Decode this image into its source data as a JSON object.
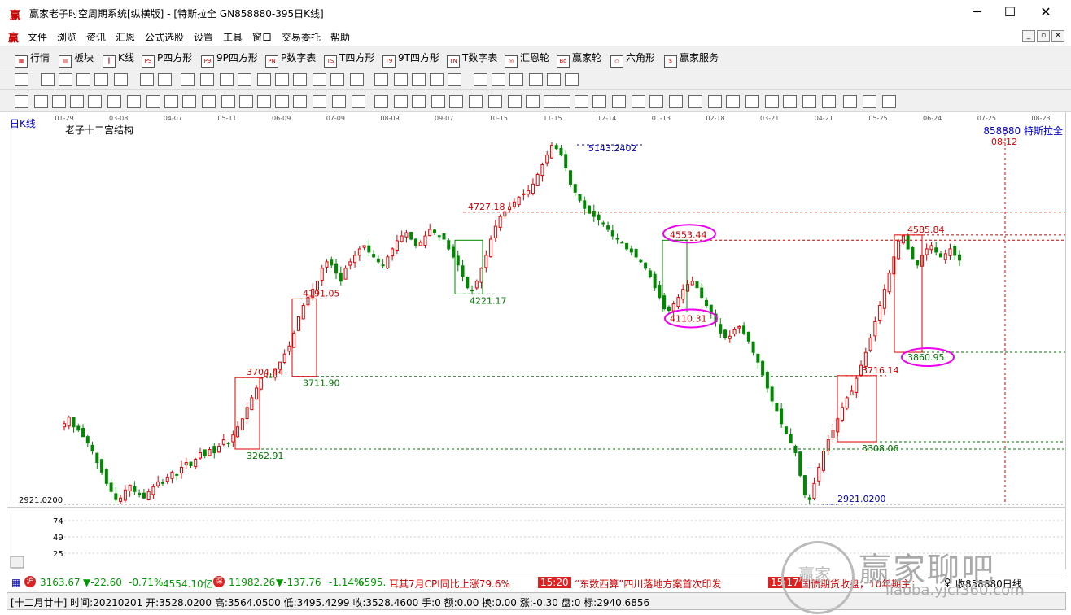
{
  "window": {
    "app_logo": "赢",
    "title": "赢家老子时空周期系统[纵横版] - [特斯拉全  GN858880-395日K线]",
    "minimize": "─",
    "maximize": "☐",
    "close": "✕"
  },
  "menu": {
    "logo": "赢",
    "items": [
      "文件",
      "浏览",
      "资讯",
      "汇恩",
      "公式选股",
      "设置",
      "工具",
      "窗口",
      "交易委托",
      "帮助"
    ],
    "mdi_buttons": [
      "_",
      "▫",
      "✕"
    ]
  },
  "toolbar1": {
    "items": [
      {
        "icon": "▦",
        "label": "行情"
      },
      {
        "icon": "▥",
        "label": "板块"
      },
      {
        "icon": "┃",
        "label": "K线"
      },
      {
        "icon": "PS",
        "label": "P四方形"
      },
      {
        "icon": "P9",
        "label": "9P四方形"
      },
      {
        "icon": "PN",
        "label": "P数字表"
      },
      {
        "icon": "TS",
        "label": "T四方形"
      },
      {
        "icon": "T9",
        "label": "9T四方形"
      },
      {
        "icon": "TN",
        "label": "T数字表"
      },
      {
        "icon": "◎",
        "label": "汇恩轮"
      },
      {
        "icon": "Bd",
        "label": "赢家轮"
      },
      {
        "icon": "◇",
        "label": "六角形"
      },
      {
        "icon": "$",
        "label": "赢家服务"
      }
    ]
  },
  "chart_header": {
    "period": "日K线",
    "indicator": "老子十二宫结构",
    "code_name": "858880 特斯拉全",
    "cursor_date": "08-12"
  },
  "chart_data": {
    "type": "candlestick",
    "x_ticks": [
      "01-29",
      "03-08",
      "04-07",
      "05-11",
      "06-09",
      "07-09",
      "08-09",
      "09-07",
      "10-15",
      "11-15",
      "12-14",
      "01-13",
      "02-18",
      "03-21",
      "04-21",
      "05-25",
      "06-24",
      "07-25",
      "08-23"
    ],
    "y_axis_min_label": "2921.0200",
    "sub_axis_ticks": [
      "74",
      "49",
      "25"
    ],
    "levels": [
      {
        "label": "5143.2402",
        "value": 5143.24,
        "color": "#0000aa"
      },
      {
        "label": "4727.18",
        "value": 4727.18,
        "color": "#cc0000"
      },
      {
        "label": "4585.84",
        "value": 4585.84,
        "color": "#cc0000"
      },
      {
        "label": "4553.44",
        "value": 4553.44,
        "color": "#cc0000"
      },
      {
        "label": "4221.17",
        "value": 4221.17,
        "color": "#007700"
      },
      {
        "label": "4191.05",
        "value": 4191.05,
        "color": "#cc0000"
      },
      {
        "label": "4110.31",
        "value": 4110.31,
        "color": "#cc0000"
      },
      {
        "label": "3860.95",
        "value": 3860.95,
        "color": "#007700"
      },
      {
        "label": "3716.14",
        "value": 3716.14,
        "color": "#cc0000"
      },
      {
        "label": "3711.90",
        "value": 3711.9,
        "color": "#007700"
      },
      {
        "label": "3704.44",
        "value": 3704.44,
        "color": "#cc0000"
      },
      {
        "label": "3308.06",
        "value": 3308.06,
        "color": "#007700"
      },
      {
        "label": "3262.91",
        "value": 3262.91,
        "color": "#007700"
      },
      {
        "label": "2921.0200",
        "value": 2921.02,
        "color": "#0000aa"
      }
    ],
    "ylim": [
      2921.02,
      5143.24
    ],
    "price_path": [
      3420,
      3460,
      3400,
      3380,
      3340,
      3300,
      3250,
      3180,
      3120,
      3050,
      3000,
      2950,
      2960,
      3010,
      3040,
      3000,
      2980,
      2960,
      3000,
      3030,
      3060,
      3050,
      3090,
      3120,
      3100,
      3150,
      3180,
      3160,
      3200,
      3240,
      3220,
      3260,
      3240,
      3280,
      3320,
      3300,
      3350,
      3400,
      3450,
      3520,
      3580,
      3640,
      3700,
      3730,
      3710,
      3760,
      3800,
      3850,
      3900,
      3980,
      4080,
      4150,
      4200,
      4250,
      4300,
      4380,
      4420,
      4400,
      4350,
      4300,
      4380,
      4420,
      4460,
      4500,
      4520,
      4480,
      4450,
      4420,
      4400,
      4450,
      4500,
      4550,
      4580,
      4600,
      4560,
      4520,
      4540,
      4580,
      4620,
      4600,
      4580,
      4560,
      4500,
      4450,
      4400,
      4330,
      4260,
      4240,
      4300,
      4380,
      4460,
      4560,
      4640,
      4700,
      4730,
      4760,
      4790,
      4820,
      4840,
      4860,
      4900,
      4960,
      5020,
      5080,
      5140,
      5120,
      5080,
      5000,
      4900,
      4850,
      4800,
      4750,
      4720,
      4700,
      4680,
      4660,
      4620,
      4580,
      4560,
      4540,
      4500,
      4480,
      4450,
      4420,
      4380,
      4330,
      4260,
      4200,
      4130,
      4120,
      4160,
      4200,
      4250,
      4280,
      4300,
      4260,
      4200,
      4150,
      4100,
      4050,
      3980,
      3950,
      3960,
      4000,
      4020,
      3980,
      3930,
      3860,
      3800,
      3720,
      3640,
      3560,
      3500,
      3420,
      3360,
      3300,
      3240,
      3100,
      2980,
      2950,
      3050,
      3150,
      3250,
      3320,
      3380,
      3450,
      3520,
      3580,
      3620,
      3700,
      3780,
      3860,
      3950,
      4050,
      4150,
      4250,
      4350,
      4450,
      4550,
      4580,
      4500,
      4440,
      4400,
      4460,
      4500,
      4520,
      4480,
      4450,
      4470,
      4500,
      4460,
      4430
    ]
  },
  "status_bar": {
    "item1_value": "3163.67",
    "item1_change": "▼-22.60",
    "item1_pct": "-0.71%",
    "item1_amount": "4554.10亿",
    "item2_value": "11982.26",
    "item2_change": "▼-137.76",
    "item2_pct": "-1.14%",
    "item2_amount": "6595.5",
    "news1": "耳其7月CPI同比上涨79.6%",
    "news2_time": "15:20",
    "news2": "“东数西算”四川落地方案首次印发",
    "news3_time": "15:17",
    "news3": "国债期货收盘，10年期主：",
    "right_text": "收858880日线"
  },
  "info_bar": {
    "text": "[十二月廿十] 时间:20210201 开:3528.0200 高:3564.0500 低:3495.4299 收:3528.4600 手:0 额:0.00 换:0.00 涨:-0.30 盘:0 标:2940.6856"
  },
  "watermark": {
    "logo_text": "赢家",
    "title": "赢家聊吧",
    "url": "liaoba.yjcf360.com"
  }
}
